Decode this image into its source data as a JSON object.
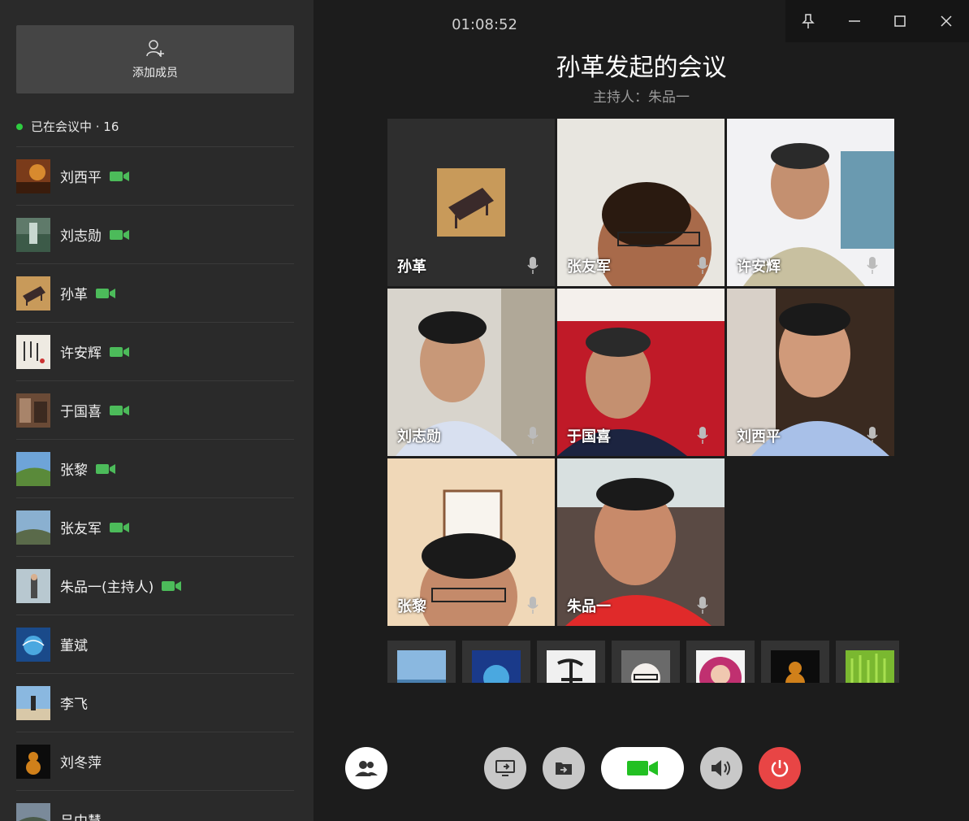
{
  "window": {
    "timer": "01:08:52",
    "title": "孙革发起的会议",
    "host": "主持人：朱品一"
  },
  "sidebar": {
    "add_member_label": "添加成员",
    "in_meeting_label": "已在会议中 · 16",
    "members": [
      {
        "name": "刘西平",
        "camera": true
      },
      {
        "name": "刘志勋",
        "camera": true
      },
      {
        "name": "孙革",
        "camera": true
      },
      {
        "name": "许安辉",
        "camera": true
      },
      {
        "name": "于国喜",
        "camera": true
      },
      {
        "name": "张黎",
        "camera": true
      },
      {
        "name": "张友军",
        "camera": true
      },
      {
        "name": "朱品一(主持人)",
        "camera": true
      },
      {
        "name": "董斌",
        "camera": false
      },
      {
        "name": "李飞",
        "camera": false
      },
      {
        "name": "刘冬萍",
        "camera": false
      },
      {
        "name": "吕中慧",
        "camera": false
      }
    ]
  },
  "grid": {
    "tiles": [
      {
        "name": "孙革"
      },
      {
        "name": "张友军"
      },
      {
        "name": "许安辉"
      },
      {
        "name": "刘志勋"
      },
      {
        "name": "于国喜"
      },
      {
        "name": "刘西平"
      },
      {
        "name": "张黎"
      },
      {
        "name": "朱品一"
      }
    ]
  },
  "colors": {
    "accent_green": "#2ecc40",
    "camera_green": "#4cbb5a",
    "hangup_red": "#e84545"
  },
  "icons": {
    "add_member": "add-user-icon",
    "pin": "pin-icon",
    "minimize": "minimize-icon",
    "maximize": "maximize-icon",
    "close": "close-icon",
    "members": "members-icon",
    "share_screen": "share-screen-icon",
    "share_file": "share-file-icon",
    "video": "video-camera-icon",
    "speaker": "speaker-icon",
    "hangup": "power-icon"
  }
}
